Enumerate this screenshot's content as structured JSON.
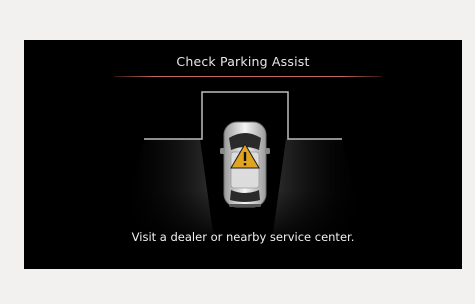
{
  "alert": {
    "title": "Check Parking Assist",
    "message": "Visit a dealer or nearby service center."
  },
  "icons": {
    "vehicle": "car-top-view-icon",
    "warning": "warning-triangle-icon"
  },
  "colors": {
    "background": "#000000",
    "divider": "#c46a5c",
    "warning": "#e0a420",
    "text": "#f2f2f2"
  }
}
